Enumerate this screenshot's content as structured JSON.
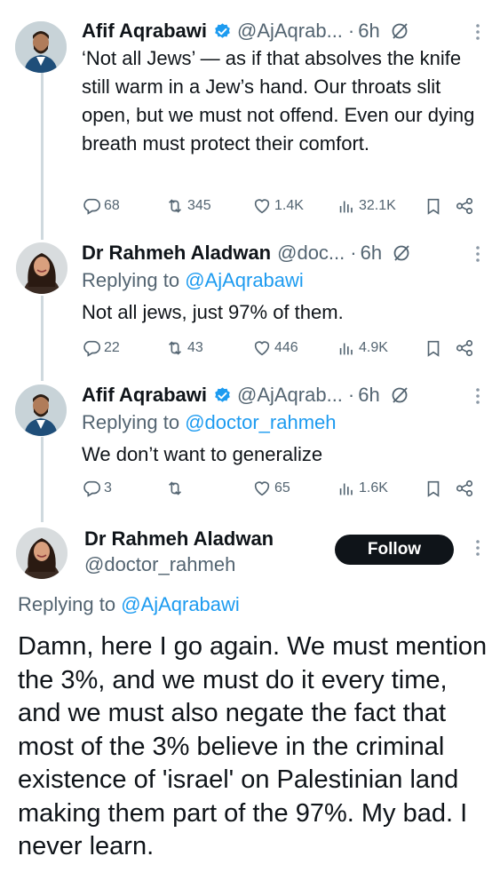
{
  "tweets": [
    {
      "name": "Afif Aqrabawi",
      "verified": true,
      "handle": "@AjAqrab...",
      "dot": "·",
      "time": "6h",
      "text": "‘Not all Jews’ — as if that absolves the knife still warm in a Jew’s hand. Our throats slit open, but we must not offend. Even our dying breath must protect their comfort.",
      "replies": "68",
      "reposts": "345",
      "likes": "1.4K",
      "views": "32.1K"
    },
    {
      "name": "Dr Rahmeh Aladwan",
      "verified": false,
      "handle": "@doc...",
      "dot": "·",
      "time": "6h",
      "replying_prefix": "Replying to ",
      "replying_to": "@AjAqrabawi",
      "text": "Not all jews, just 97% of them.",
      "replies": "22",
      "reposts": "43",
      "likes": "446",
      "views": "4.9K"
    },
    {
      "name": "Afif Aqrabawi",
      "verified": true,
      "handle": "@AjAqrab...",
      "dot": "·",
      "time": "6h",
      "replying_prefix": "Replying to ",
      "replying_to": "@doctor_rahmeh",
      "text": "We don’t want to generalize",
      "replies": "3",
      "reposts": "",
      "likes": "65",
      "views": "1.6K"
    }
  ],
  "main_tweet": {
    "name": "Dr Rahmeh Aladwan",
    "handle": "@doctor_rahmeh",
    "follow_label": "Follow",
    "replying_prefix": "Replying to ",
    "replying_to": "@AjAqrabawi",
    "text": "Damn, here I go again. We must mention the 3%, and we must do it every time, and we must also negate the fact that most of the 3% believe in the criminal existence of 'israel' on Palestinian land making them part of the 97%. My bad. I never learn."
  },
  "colors": {
    "text": "#0f1419",
    "secondary": "#536471",
    "link": "#1d9bf0",
    "verified": "#1d9bf0",
    "thread_line": "#cfd9de",
    "follow_bg": "#0f1419"
  },
  "icons": [
    "verified-badge-icon",
    "grok-icon",
    "more-icon",
    "reply-icon",
    "repost-icon",
    "like-icon",
    "views-icon",
    "bookmark-icon",
    "share-icon"
  ]
}
